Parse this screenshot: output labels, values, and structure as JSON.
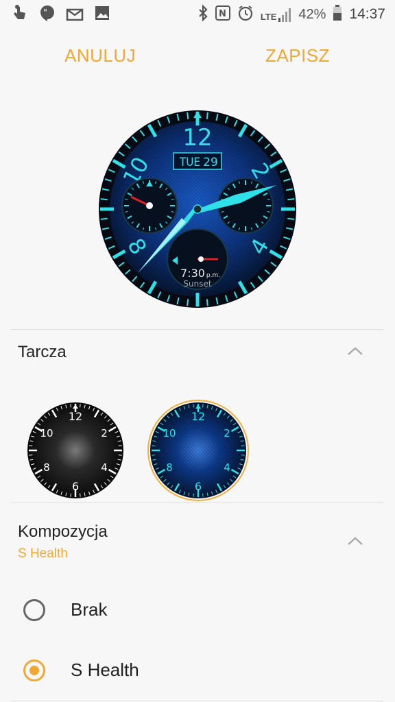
{
  "status_bar": {
    "icons_left": [
      "touch-icon",
      "hangouts-icon",
      "mail-icon",
      "gallery-icon"
    ],
    "icons_right": [
      "bluetooth-icon",
      "nfc-icon",
      "alarm-icon",
      "lte-signal-icon",
      "battery-icon"
    ],
    "network": "LTE",
    "battery": "42%",
    "time": "14:37"
  },
  "top_bar": {
    "cancel_label": "ANULUJ",
    "save_label": "ZAPISZ"
  },
  "preview": {
    "day": "TUE",
    "date": "29",
    "numbers": [
      "12",
      "2",
      "4",
      "8",
      "10"
    ],
    "sunset_time": "7:30",
    "sunset_ampm": "p.m.",
    "sunset_label": "Sunset"
  },
  "dial_section": {
    "title": "Tarcza",
    "options": [
      {
        "name": "black",
        "numbers": [
          "12",
          "2",
          "4",
          "6",
          "8",
          "10"
        ]
      },
      {
        "name": "blue",
        "numbers": [
          "12",
          "2",
          "4",
          "6",
          "8",
          "10"
        ],
        "selected": true
      }
    ]
  },
  "composition_section": {
    "title": "Kompozycja",
    "subtitle": "S Health",
    "options": [
      {
        "label": "Brak",
        "selected": false
      },
      {
        "label": "S Health",
        "selected": true
      }
    ]
  },
  "colors": {
    "accent": "#f0a830",
    "watch_cyan": "#2fe0e8",
    "watch_blue": "#0b3d8c"
  }
}
